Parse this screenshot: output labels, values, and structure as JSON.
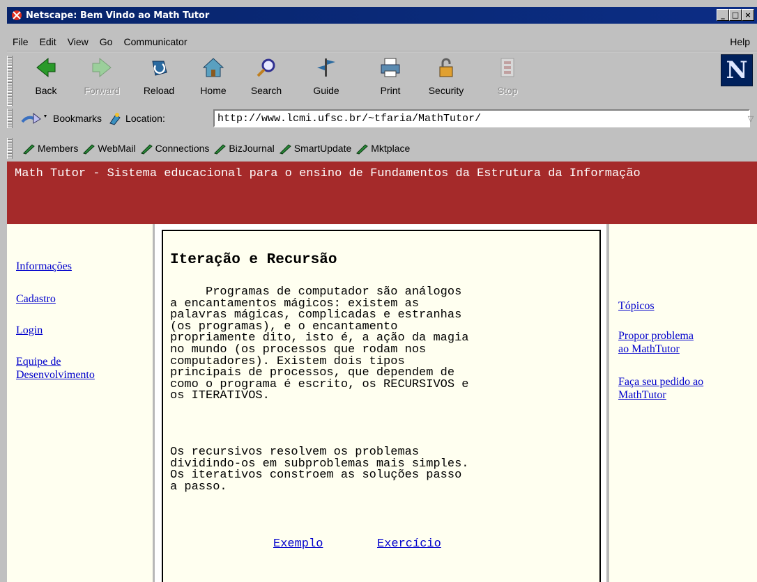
{
  "window": {
    "title": "Netscape: Bem Vindo ao Math Tutor",
    "controls": [
      "_",
      "□",
      "×"
    ]
  },
  "menu": {
    "items": [
      "File",
      "Edit",
      "View",
      "Go",
      "Communicator"
    ],
    "help": "Help"
  },
  "toolbar": {
    "buttons": [
      {
        "label": "Back",
        "icon": "back-icon",
        "enabled": true
      },
      {
        "label": "Forward",
        "icon": "forward-icon",
        "enabled": false
      },
      {
        "label": "Reload",
        "icon": "reload-icon",
        "enabled": true
      },
      {
        "label": "Home",
        "icon": "home-icon",
        "enabled": true
      },
      {
        "label": "Search",
        "icon": "search-icon",
        "enabled": true
      },
      {
        "label": "Guide",
        "icon": "guide-icon",
        "enabled": true
      },
      {
        "label": "Print",
        "icon": "print-icon",
        "enabled": true
      },
      {
        "label": "Security",
        "icon": "security-icon",
        "enabled": true
      },
      {
        "label": "Stop",
        "icon": "stop-icon",
        "enabled": false
      }
    ],
    "logo": "N"
  },
  "location": {
    "bookmarks_label": "Bookmarks",
    "location_label": "Location:",
    "url": "http://www.lcmi.ufsc.br/~tfaria/MathTutor/"
  },
  "personal_toolbar": {
    "items": [
      "Members",
      "WebMail",
      "Connections",
      "BizJournal",
      "SmartUpdate",
      "Mktplace"
    ]
  },
  "page": {
    "banner": "Math Tutor - Sistema educacional para o ensino de Fundamentos da Estrutura da Informação",
    "left_nav": [
      "Informações",
      "Cadastro",
      "Login",
      "Equipe de",
      "Desenvolvimento"
    ],
    "right_nav": [
      "Tópicos",
      "Propor problema",
      "ao MathTutor",
      "Faça seu pedido ao",
      "MathTutor"
    ],
    "heading": "Iteração e Recursão",
    "paragraph1": "     Programas de computador são análogos\na encantamentos mágicos: existem as\npalavras mágicas, complicadas e estranhas\n(os programas), e o encantamento\npropriamente dito, isto é, a ação da magia\nno mundo (os processos que rodam nos\ncomputadores). Existem dois tipos\nprincipais de processos, que dependem de\ncomo o programa é escrito, os RECURSIVOS e\nos ITERATIVOS.",
    "paragraph2": "Os recursivos resolvem os problemas\ndividindo-os em subproblemas mais simples.\nOs iterativos constroem as soluções passo\na passo.",
    "link_example": "Exemplo",
    "link_exercise": "Exercício"
  },
  "colors": {
    "banner": "#a52a2a",
    "titlebar": "#08246b",
    "link": "#0000cc",
    "panel": "#fffff0"
  }
}
